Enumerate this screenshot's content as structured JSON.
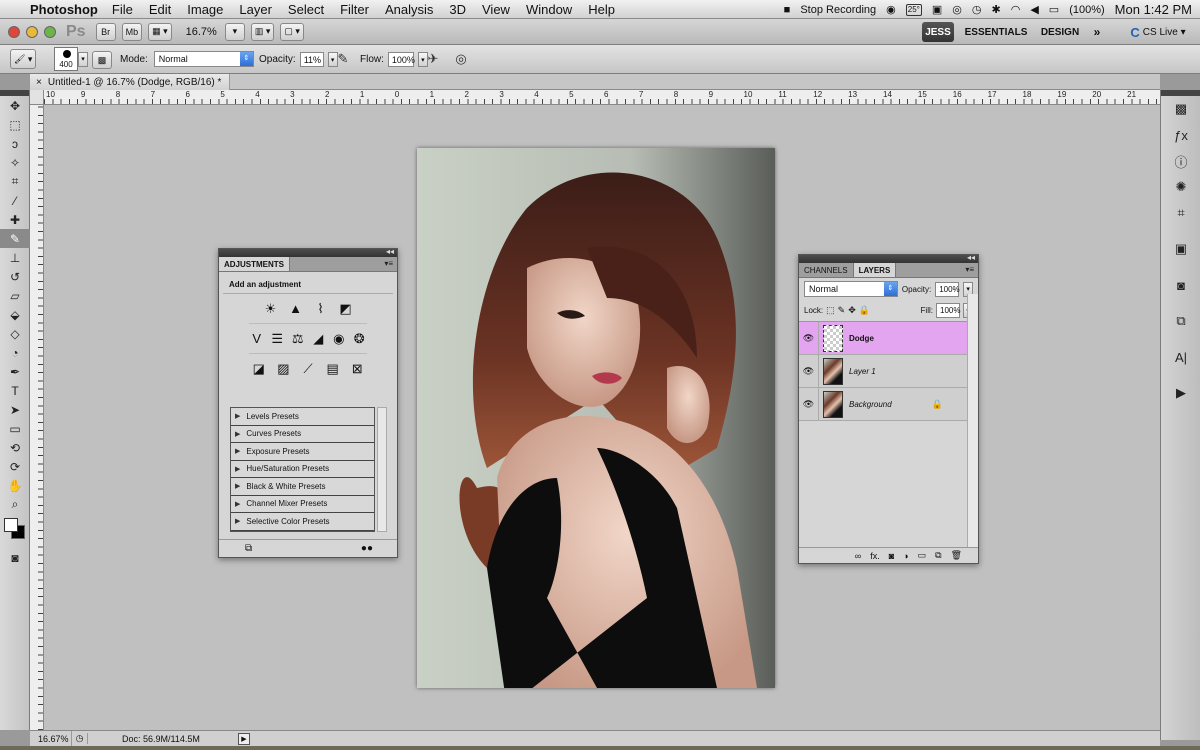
{
  "menubar": {
    "app_name": "Photoshop",
    "menus": [
      "File",
      "Edit",
      "Image",
      "Layer",
      "Select",
      "Filter",
      "Analysis",
      "3D",
      "View",
      "Window",
      "Help"
    ],
    "status_recording": "Stop Recording",
    "temp": "25°",
    "battery": "(100%)",
    "clock": "Mon 1:42 PM"
  },
  "appbar": {
    "ps_badge": "Ps",
    "br_label": "Br",
    "mb_label": "Mb",
    "zoom": "16.7%",
    "workspaces": {
      "active": "JESS",
      "essentials": "ESSENTIALS",
      "design": "DESIGN",
      "more": "»"
    },
    "cslive": "CS Live"
  },
  "options": {
    "brush_size": "400",
    "mode_label": "Mode:",
    "mode_value": "Normal",
    "opacity_label": "Opacity:",
    "opacity_value": "11%",
    "flow_label": "Flow:",
    "flow_value": "100%"
  },
  "document": {
    "tab_title": "Untitled-1 @ 16.7% (Dodge, RGB/16) *",
    "close_glyph": "×"
  },
  "rulers": {
    "top": [
      "10",
      "9",
      "8",
      "7",
      "6",
      "5",
      "4",
      "3",
      "2",
      "1",
      "0",
      "1",
      "2",
      "3",
      "4",
      "5",
      "6",
      "7",
      "8",
      "9",
      "10",
      "11",
      "12",
      "13",
      "14",
      "15",
      "16",
      "17",
      "18",
      "19",
      "20",
      "21"
    ]
  },
  "adjustments": {
    "tab": "ADJUSTMENTS",
    "heading": "Add an adjustment",
    "presets": [
      "Levels Presets",
      "Curves Presets",
      "Exposure Presets",
      "Hue/Saturation Presets",
      "Black & White Presets",
      "Channel Mixer Presets",
      "Selective Color Presets"
    ]
  },
  "layers_panel": {
    "tabs": [
      "CHANNELS",
      "LAYERS"
    ],
    "blend_mode": "Normal",
    "opacity_label": "Opacity:",
    "opacity_value": "100%",
    "lock_label": "Lock:",
    "fill_label": "Fill:",
    "fill_value": "100%",
    "layers": [
      {
        "name": "Dodge",
        "selected": true
      },
      {
        "name": "Layer 1",
        "selected": false
      },
      {
        "name": "Background",
        "selected": false
      }
    ],
    "footer_fx": "fx."
  },
  "statusbar": {
    "zoom": "16.67%",
    "doc": "Doc: 56.9M/114.5M"
  },
  "colors": {
    "layer_selected": "#e3a4f0",
    "panel_bg": "#d6d6d6",
    "canvas_bg": "#c0c0c0"
  }
}
